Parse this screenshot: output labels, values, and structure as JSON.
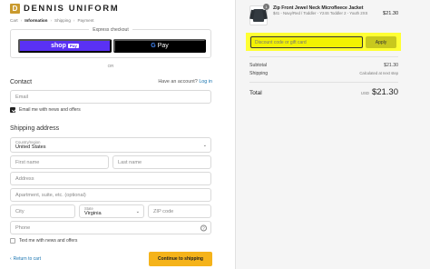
{
  "brand": {
    "badge": "D",
    "name": "DENNIS UNIFORM"
  },
  "breadcrumb": [
    "Cart",
    "Information",
    "Shipping",
    "Payment"
  ],
  "express": {
    "label": "Express checkout",
    "shoppay_label": "shop",
    "shoppay_badge": "Pay",
    "gpay_g": "G",
    "gpay_label": "Pay"
  },
  "or_label": "OR",
  "contact": {
    "title": "Contact",
    "login_prompt": "Have an account?",
    "login_link": "Log in",
    "email_placeholder": "Email",
    "news_label": "Email me with news and offers"
  },
  "shipping": {
    "title": "Shipping address",
    "country_label": "Country/region",
    "country_value": "United States",
    "first_name": "First name",
    "last_name": "Last name",
    "address": "Address",
    "apartment": "Apartment, suite, etc. (optional)",
    "city": "City",
    "state_label": "State",
    "state_value": "Virginia",
    "zip": "ZIP code",
    "phone": "Phone",
    "text_label": "Text me with news and offers"
  },
  "footer": {
    "return_label": "Return to cart",
    "continue_label": "Continue to shipping"
  },
  "order": {
    "quantity": "1",
    "product_name": "Zip Front Jewel Neck Microfleece Jacket",
    "product_variant": "$41 - Navy/Red / Toddler - Y24S Toddler 2 - Youth 2XS",
    "product_price": "$21.30",
    "discount_placeholder": "Discount code or gift card",
    "apply_label": "Apply",
    "subtotal_label": "Subtotal",
    "subtotal_value": "$21.30",
    "shipping_label": "Shipping",
    "shipping_value": "Calculated at next step",
    "total_label": "Total",
    "total_currency": "USD",
    "total_value": "$21.30"
  }
}
